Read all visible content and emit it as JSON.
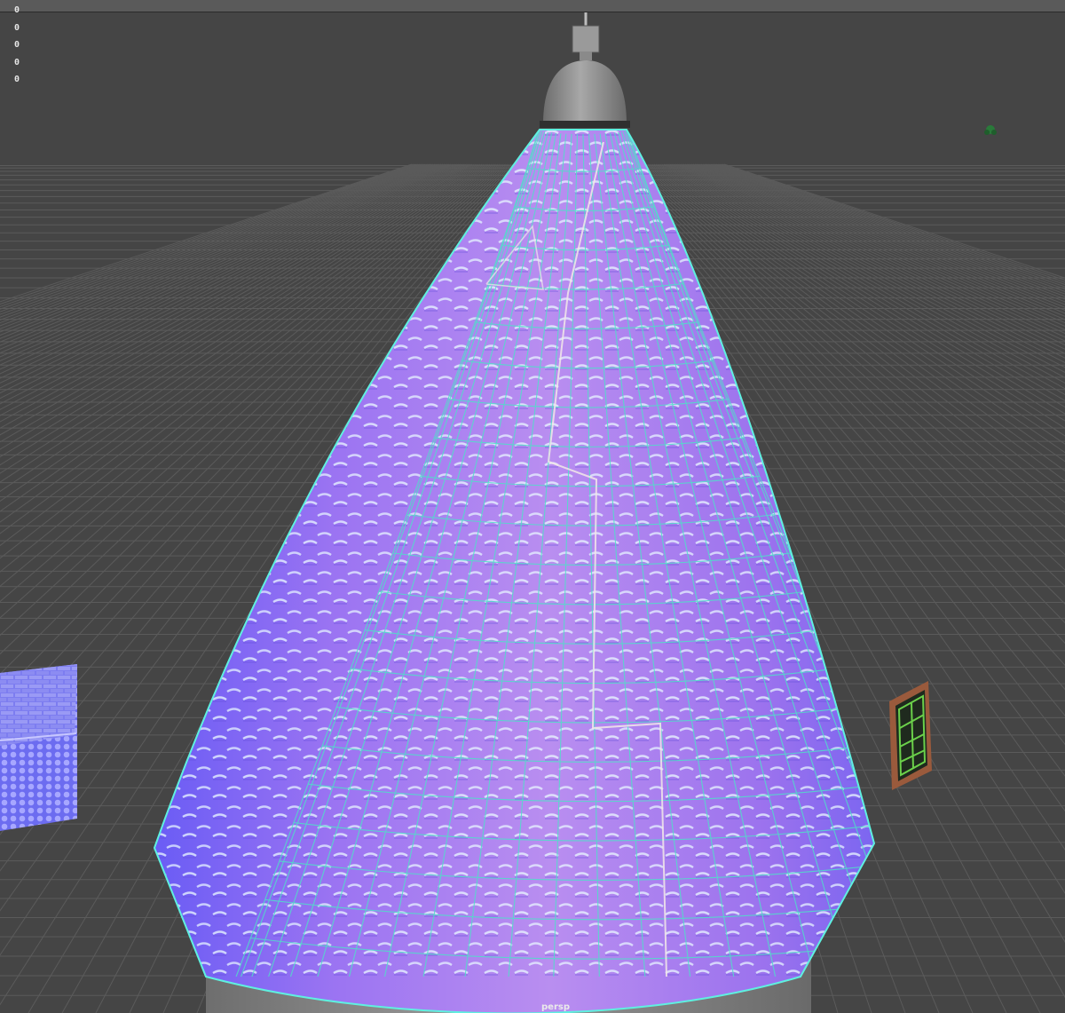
{
  "viewport": {
    "camera": "persp",
    "hud_values": [
      "0",
      "0",
      "0",
      "0",
      "0"
    ]
  },
  "scene": {
    "background_color": "#454545",
    "grid_color": "#5b5b5b",
    "normal_map_color": "#9a6cf0",
    "wireframe_color": "#4fe0c8",
    "objects": [
      "cone-roof-mesh",
      "ceiling-light-fixture",
      "textured-plane-left",
      "window-frame",
      "tower-base"
    ]
  },
  "icons": {
    "light_gizmo": "light-gizmo-icon"
  }
}
